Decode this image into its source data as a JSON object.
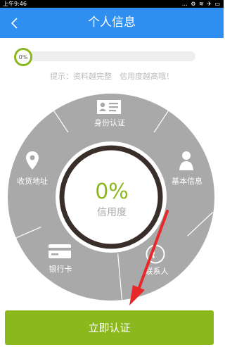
{
  "status_bar": {
    "time": "上午9:46",
    "icons": "… ⚙ ≋ ✈ ▭"
  },
  "header": {
    "back_icon": "chevron-left-icon",
    "title": "个人信息"
  },
  "progress": {
    "value_text": "0%",
    "fraction": 0
  },
  "tip": "提示：资料越完整　信用度越高哦！",
  "wheel": {
    "segments": [
      {
        "label": "身份认证",
        "icon": "id-card-icon"
      },
      {
        "label": "基本信息",
        "icon": "person-icon"
      },
      {
        "label": "联系人",
        "icon": "phone-icon"
      },
      {
        "label": "银行卡",
        "icon": "bank-card-icon"
      },
      {
        "label": "收货地址",
        "icon": "location-pin-icon"
      }
    ],
    "center": {
      "value": "0%",
      "label": "信用度"
    }
  },
  "annotation": {
    "type": "red-arrow",
    "color": "#e8272b"
  },
  "button": {
    "label": "立即认证"
  },
  "colors": {
    "accent": "#8ab81d",
    "title_bar": "#2f8ff0",
    "wheel": "#a9a9a9",
    "ring": "#3a2e2a"
  }
}
